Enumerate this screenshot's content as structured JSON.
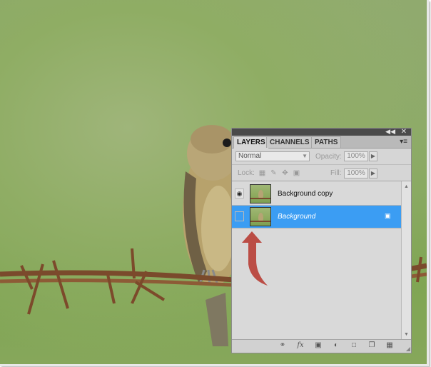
{
  "panel": {
    "tabs": [
      "LAYERS",
      "CHANNELS",
      "PATHS"
    ],
    "blend_mode": "Normal",
    "opacity_label": "Opacity:",
    "opacity_value": "100%",
    "lock_label": "Lock:",
    "fill_label": "Fill:",
    "fill_value": "100%",
    "layers": [
      {
        "name": "Background copy",
        "visible": true,
        "selected": false
      },
      {
        "name": "Background",
        "visible": false,
        "selected": true,
        "locked": true
      }
    ]
  },
  "icons": [
    "collapse-icon",
    "close-icon",
    "panel-menu-icon",
    "eye-icon",
    "lock-icon",
    "link-icon",
    "fx-icon",
    "mask-icon",
    "adjustment-icon",
    "folder-icon",
    "new-layer-icon",
    "trash-icon"
  ],
  "colors": {
    "selection": "#3b9df3",
    "arrow": "#b5342a",
    "photo_green": "#87a95e"
  }
}
